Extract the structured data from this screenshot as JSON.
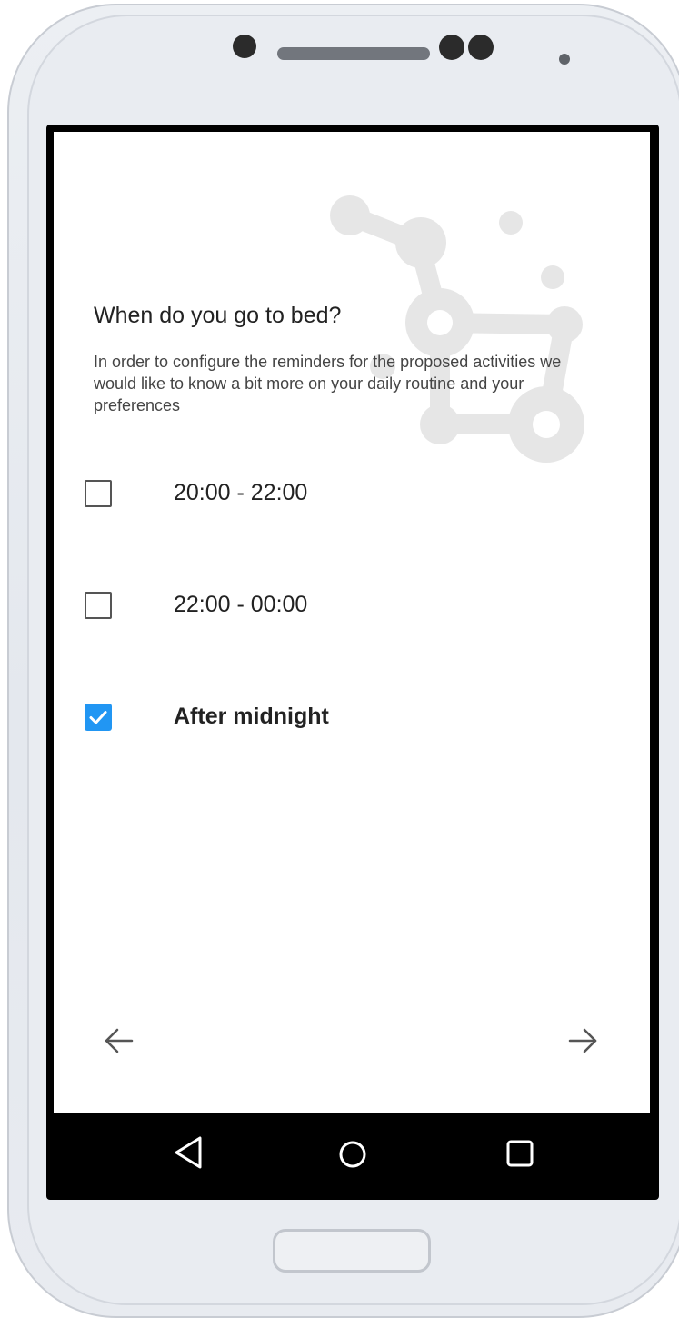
{
  "question": {
    "title": "When do you go to bed?",
    "description": "In order to configure the reminders for the proposed activities we would like to know a bit more on your daily routine and your preferences"
  },
  "options": [
    {
      "label": "20:00 - 22:00",
      "checked": false
    },
    {
      "label": "22:00 - 00:00",
      "checked": false
    },
    {
      "label": "After midnight",
      "checked": true
    }
  ],
  "navigation": {
    "back_icon": "arrow-left-icon",
    "next_icon": "arrow-right-icon"
  },
  "system_nav": {
    "back_icon": "triangle-back-icon",
    "home_icon": "circle-home-icon",
    "recents_icon": "square-recents-icon"
  },
  "colors": {
    "accent": "#2196f3",
    "decoration": "#e6e6e6",
    "nav_bar": "#000000"
  }
}
